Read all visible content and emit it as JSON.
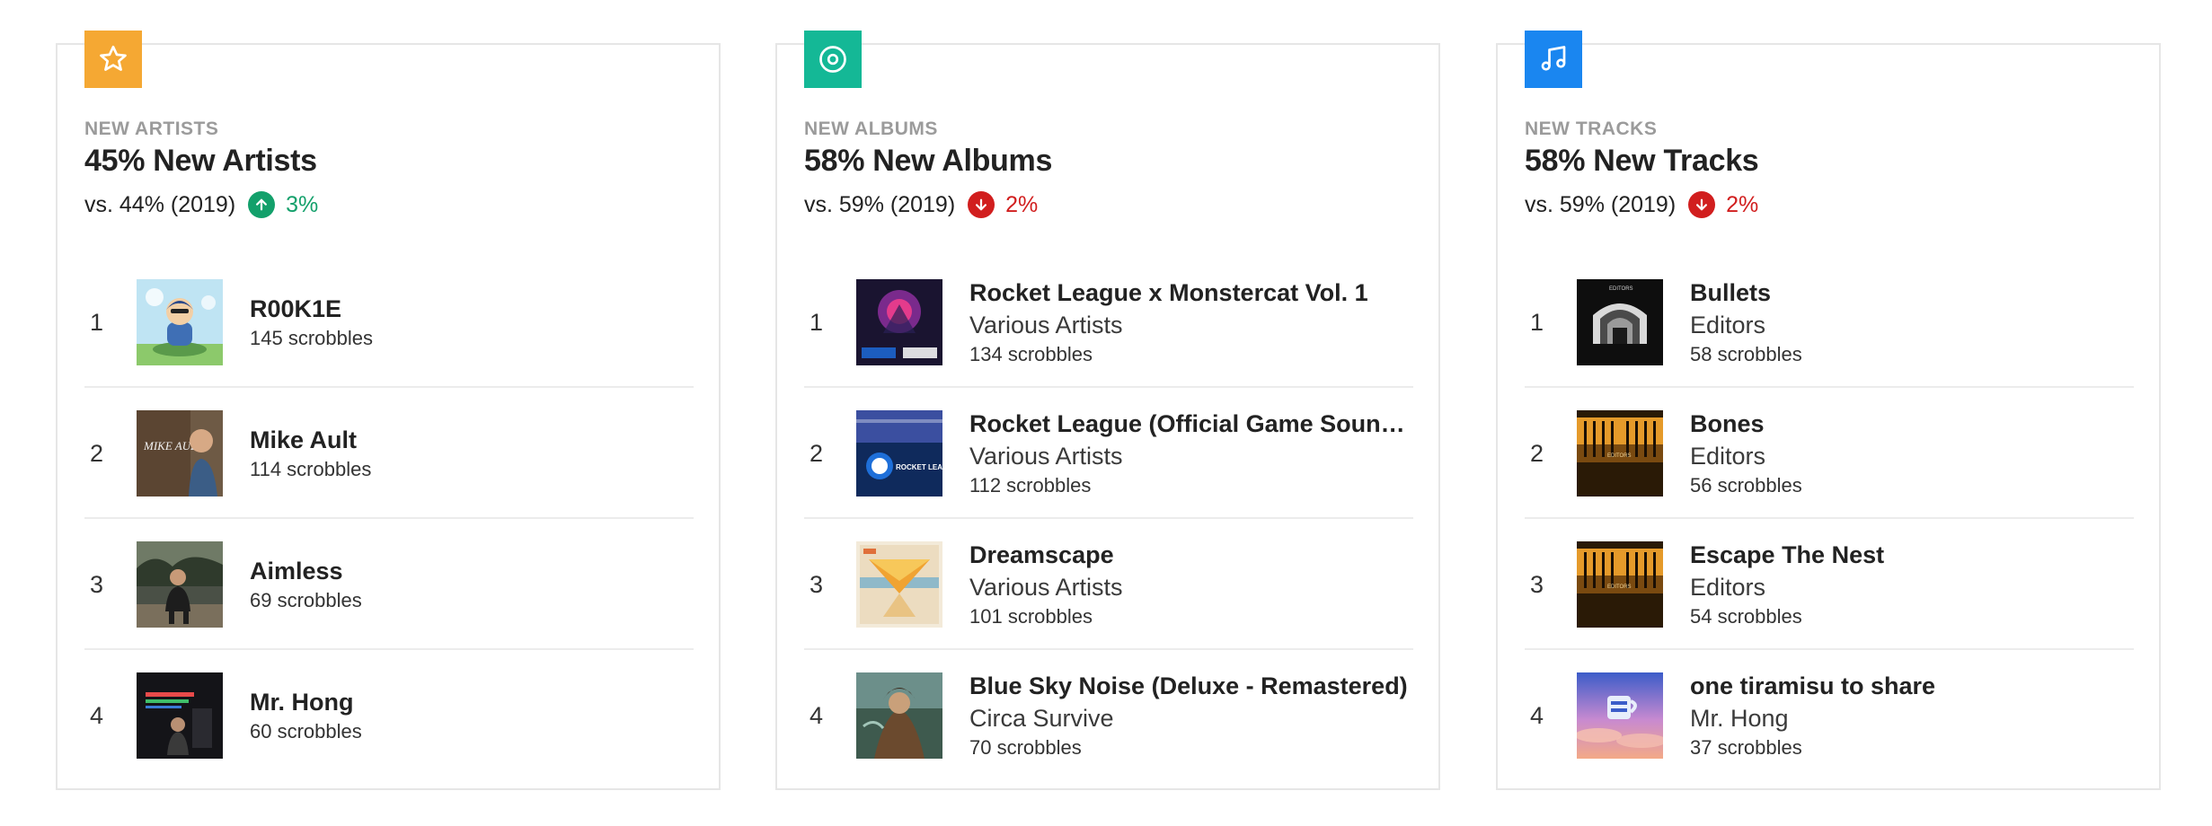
{
  "colors": {
    "badge_artists": "#f5a833",
    "badge_albums": "#14b896",
    "badge_tracks": "#1a86f0",
    "up": "#13a06b",
    "down": "#d11e1e",
    "eyebrow": "#9b9b9b",
    "border": "#e6e6e6"
  },
  "panels": [
    {
      "badge_icon": "star-icon",
      "eyebrow": "NEW ARTISTS",
      "headline": "45% New Artists",
      "compare": "vs. 44% (2019)",
      "change_direction": "up",
      "change_value": "3%",
      "items": [
        {
          "rank": "1",
          "title": "R00K1E",
          "scrobbles": "145 scrobbles"
        },
        {
          "rank": "2",
          "title": "Mike Ault",
          "scrobbles": "114 scrobbles"
        },
        {
          "rank": "3",
          "title": "Aimless",
          "scrobbles": "69 scrobbles"
        },
        {
          "rank": "4",
          "title": "Mr. Hong",
          "scrobbles": "60 scrobbles"
        }
      ]
    },
    {
      "badge_icon": "disc-icon",
      "eyebrow": "NEW ALBUMS",
      "headline": "58% New Albums",
      "compare": "vs. 59% (2019)",
      "change_direction": "down",
      "change_value": "2%",
      "items": [
        {
          "rank": "1",
          "title": "Rocket League x Monstercat Vol. 1",
          "subtitle": "Various Artists",
          "scrobbles": "134 scrobbles"
        },
        {
          "rank": "2",
          "title": "Rocket League (Official Game Soundt...",
          "subtitle": "Various Artists",
          "scrobbles": "112 scrobbles"
        },
        {
          "rank": "3",
          "title": "Dreamscape",
          "subtitle": "Various Artists",
          "scrobbles": "101 scrobbles"
        },
        {
          "rank": "4",
          "title": "Blue Sky Noise (Deluxe - Remastered)",
          "subtitle": "Circa Survive",
          "scrobbles": "70 scrobbles"
        }
      ]
    },
    {
      "badge_icon": "music-note-icon",
      "eyebrow": "NEW TRACKS",
      "headline": "58% New Tracks",
      "compare": "vs. 59% (2019)",
      "change_direction": "down",
      "change_value": "2%",
      "items": [
        {
          "rank": "1",
          "title": "Bullets",
          "subtitle": "Editors",
          "scrobbles": "58 scrobbles"
        },
        {
          "rank": "2",
          "title": "Bones",
          "subtitle": "Editors",
          "scrobbles": "56 scrobbles"
        },
        {
          "rank": "3",
          "title": "Escape The Nest",
          "subtitle": "Editors",
          "scrobbles": "54 scrobbles"
        },
        {
          "rank": "4",
          "title": "one tiramisu to share",
          "subtitle": "Mr. Hong",
          "scrobbles": "37 scrobbles"
        }
      ]
    }
  ],
  "artwork": {
    "mike_ault": "MIKE AULT",
    "rocket_league": "ROCKET LEAGUE",
    "editors": "EDITORS"
  }
}
